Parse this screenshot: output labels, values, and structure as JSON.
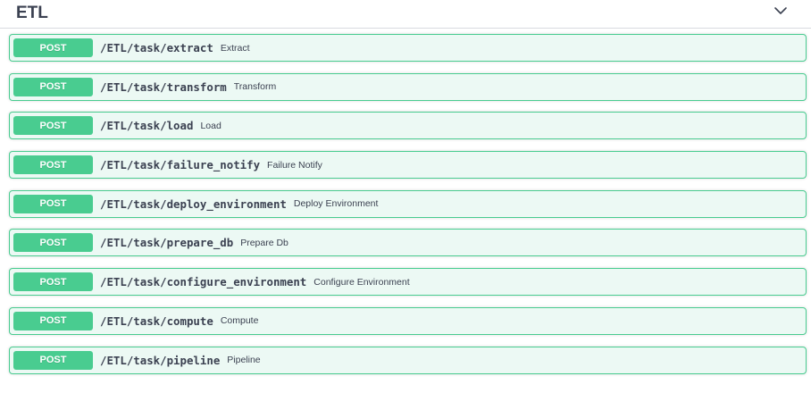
{
  "section": {
    "title": "ETL",
    "toggle_icon": "chevron-down-icon"
  },
  "colors": {
    "post_method": "#49cc90",
    "post_background": "#ecf9f4",
    "text": "#3b4151"
  },
  "operations": [
    {
      "method": "POST",
      "path": "/ETL/task/extract",
      "summary": "Extract"
    },
    {
      "method": "POST",
      "path": "/ETL/task/transform",
      "summary": "Transform"
    },
    {
      "method": "POST",
      "path": "/ETL/task/load",
      "summary": "Load"
    },
    {
      "method": "POST",
      "path": "/ETL/task/failure_notify",
      "summary": "Failure Notify"
    },
    {
      "method": "POST",
      "path": "/ETL/task/deploy_environment",
      "summary": "Deploy Environment"
    },
    {
      "method": "POST",
      "path": "/ETL/task/prepare_db",
      "summary": "Prepare Db"
    },
    {
      "method": "POST",
      "path": "/ETL/task/configure_environment",
      "summary": "Configure Environment"
    },
    {
      "method": "POST",
      "path": "/ETL/task/compute",
      "summary": "Compute"
    },
    {
      "method": "POST",
      "path": "/ETL/task/pipeline",
      "summary": "Pipeline"
    }
  ]
}
